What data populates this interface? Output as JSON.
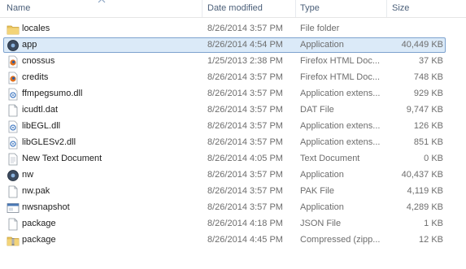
{
  "columns": {
    "name": "Name",
    "date": "Date modified",
    "type": "Type",
    "size": "Size"
  },
  "files": [
    {
      "name": "locales",
      "date": "8/26/2014 3:57 PM",
      "type": "File folder",
      "size": "",
      "icon": "folder-icon",
      "selected": false
    },
    {
      "name": "app",
      "date": "8/26/2014 4:54 PM",
      "type": "Application",
      "size": "40,449 KB",
      "icon": "app-exe-icon",
      "selected": true
    },
    {
      "name": "cnossus",
      "date": "1/25/2013 2:38 PM",
      "type": "Firefox HTML Doc...",
      "size": "37 KB",
      "icon": "firefox-html-icon",
      "selected": false
    },
    {
      "name": "credits",
      "date": "8/26/2014 3:57 PM",
      "type": "Firefox HTML Doc...",
      "size": "748 KB",
      "icon": "firefox-html-icon",
      "selected": false
    },
    {
      "name": "ffmpegsumo.dll",
      "date": "8/26/2014 3:57 PM",
      "type": "Application extens...",
      "size": "929 KB",
      "icon": "dll-icon",
      "selected": false
    },
    {
      "name": "icudtl.dat",
      "date": "8/26/2014 3:57 PM",
      "type": "DAT File",
      "size": "9,747 KB",
      "icon": "generic-file-icon",
      "selected": false
    },
    {
      "name": "libEGL.dll",
      "date": "8/26/2014 3:57 PM",
      "type": "Application extens...",
      "size": "126 KB",
      "icon": "dll-icon",
      "selected": false
    },
    {
      "name": "libGLESv2.dll",
      "date": "8/26/2014 3:57 PM",
      "type": "Application extens...",
      "size": "851 KB",
      "icon": "dll-icon",
      "selected": false
    },
    {
      "name": "New Text Document",
      "date": "8/26/2014 4:05 PM",
      "type": "Text Document",
      "size": "0 KB",
      "icon": "text-document-icon",
      "selected": false
    },
    {
      "name": "nw",
      "date": "8/26/2014 3:57 PM",
      "type": "Application",
      "size": "40,437 KB",
      "icon": "app-exe-icon",
      "selected": false
    },
    {
      "name": "nw.pak",
      "date": "8/26/2014 3:57 PM",
      "type": "PAK File",
      "size": "4,119 KB",
      "icon": "generic-file-icon",
      "selected": false
    },
    {
      "name": "nwsnapshot",
      "date": "8/26/2014 3:57 PM",
      "type": "Application",
      "size": "4,289 KB",
      "icon": "window-app-icon",
      "selected": false
    },
    {
      "name": "package",
      "date": "8/26/2014 4:18 PM",
      "type": "JSON File",
      "size": "1 KB",
      "icon": "generic-file-icon",
      "selected": false
    },
    {
      "name": "package",
      "date": "8/26/2014 4:45 PM",
      "type": "Compressed (zipp...",
      "size": "12 KB",
      "icon": "zip-folder-icon",
      "selected": false
    }
  ],
  "colors": {
    "selection_fill": "#dbeaf8",
    "selection_border": "#7da2ce",
    "header_text": "#4c607a",
    "folder": "#e8c25a"
  }
}
